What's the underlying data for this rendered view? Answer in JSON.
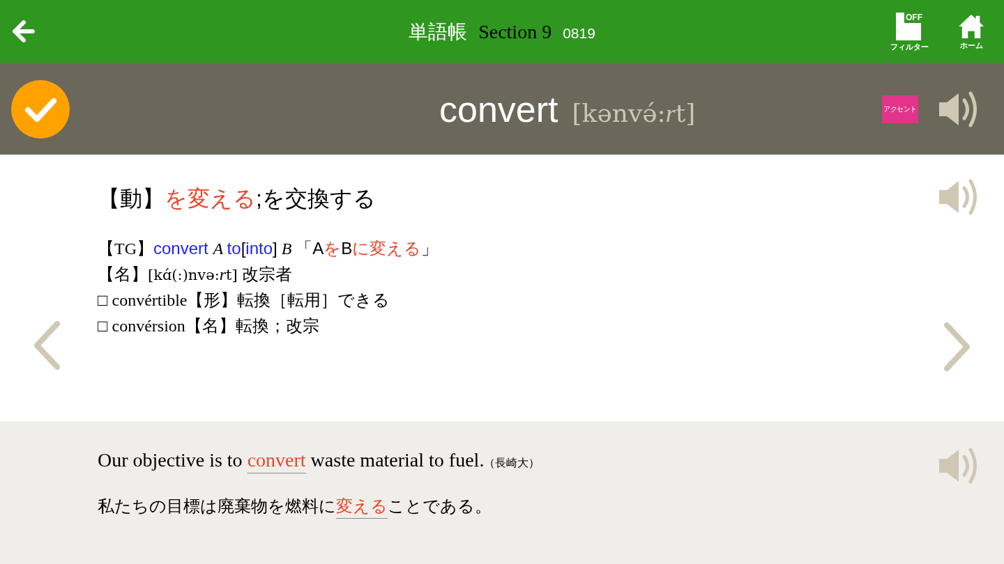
{
  "header": {
    "title": "単語帳",
    "section": "Section 9",
    "number": "0819",
    "filter": {
      "status": "OFF",
      "label": "フィルター"
    },
    "home": {
      "label": "ホーム"
    }
  },
  "word": {
    "checked": true,
    "headword": "convert",
    "pronunciation": [
      {
        "kind": "plain",
        "text": "[kənvə́:"
      },
      {
        "kind": "italic",
        "text": "r"
      },
      {
        "kind": "plain",
        "text": "t]"
      }
    ],
    "accent_button": "アクセント"
  },
  "meaning": {
    "segments": [
      {
        "kind": "text",
        "text": "【動】"
      },
      {
        "kind": "emphasis",
        "text": "を変える"
      },
      {
        "kind": "text",
        "text": ";を交換する"
      }
    ]
  },
  "details": [
    {
      "segments": [
        {
          "kind": "serif",
          "text": "【TG】"
        },
        {
          "kind": "phrase",
          "text": "convert "
        },
        {
          "kind": "variable",
          "text": "A "
        },
        {
          "kind": "phrase",
          "text": "to"
        },
        {
          "kind": "text",
          "text": "["
        },
        {
          "kind": "phrase",
          "text": "into"
        },
        {
          "kind": "text",
          "text": "]"
        },
        {
          "kind": "variable",
          "text": " B "
        },
        {
          "kind": "text",
          "text": "「A"
        },
        {
          "kind": "emphasis",
          "text": "を"
        },
        {
          "kind": "text",
          "text": "B"
        },
        {
          "kind": "emphasis",
          "text": "に変える"
        },
        {
          "kind": "text",
          "text": "」"
        }
      ]
    },
    {
      "segments": [
        {
          "kind": "text",
          "text": "【名】"
        },
        {
          "kind": "ipa",
          "text": "[kɑ́(:)nvə:"
        },
        {
          "kind": "variable",
          "text": "r"
        },
        {
          "kind": "ipa",
          "text": "t] "
        },
        {
          "kind": "text",
          "text": "改宗者"
        }
      ]
    },
    {
      "segments": [
        {
          "kind": "serif",
          "text": "□ convértible"
        },
        {
          "kind": "text",
          "text": "【形】転換［転用］できる"
        }
      ]
    },
    {
      "segments": [
        {
          "kind": "serif",
          "text": "□ convérsion"
        },
        {
          "kind": "text",
          "text": "【名】転換；改宗"
        }
      ]
    }
  ],
  "example": {
    "english": {
      "segments": [
        {
          "kind": "text",
          "text": "Our objective is to "
        },
        {
          "kind": "target",
          "text": "convert"
        },
        {
          "kind": "text",
          "text": " waste material to fuel."
        },
        {
          "kind": "source",
          "text": "（長崎大）"
        }
      ]
    },
    "japanese": {
      "segments": [
        {
          "kind": "text",
          "text": "私たちの目標は廃棄物を燃料に"
        },
        {
          "kind": "target",
          "text": "変える"
        },
        {
          "kind": "text",
          "text": "ことである。"
        }
      ]
    }
  }
}
